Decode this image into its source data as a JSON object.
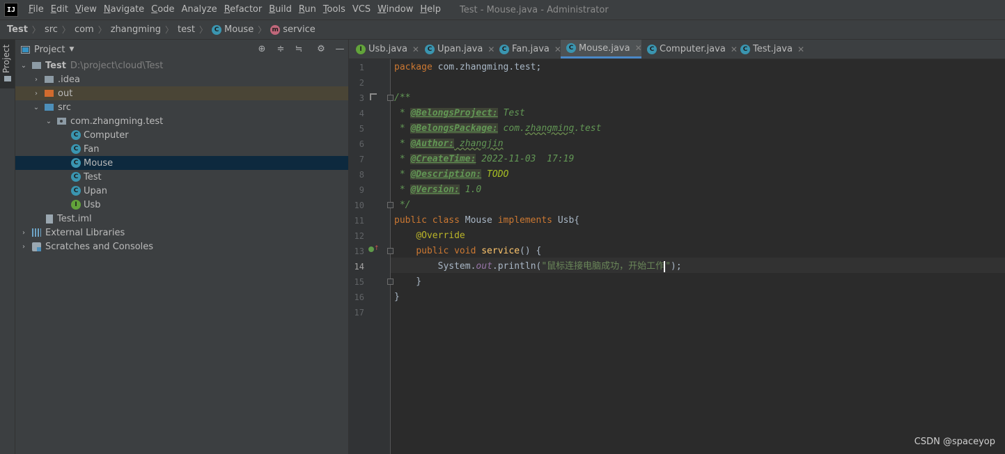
{
  "window_title": "Test - Mouse.java - Administrator",
  "logo_text": "IJ",
  "menu": [
    {
      "m": "F",
      "r": "ile"
    },
    {
      "m": "E",
      "r": "dit"
    },
    {
      "m": "V",
      "r": "iew"
    },
    {
      "m": "N",
      "r": "avigate"
    },
    {
      "m": "C",
      "r": "ode"
    },
    {
      "m": "",
      "r": "Analyze"
    },
    {
      "m": "R",
      "r": "efactor"
    },
    {
      "m": "B",
      "r": "uild"
    },
    {
      "m": "R",
      "r": "un"
    },
    {
      "m": "T",
      "r": "ools"
    },
    {
      "m": "",
      "r": "VCS"
    },
    {
      "m": "W",
      "r": "indow"
    },
    {
      "m": "H",
      "r": "elp"
    }
  ],
  "breadcrumb": {
    "items": [
      "Test",
      "src",
      "com",
      "zhangming",
      "test",
      "Mouse",
      "service"
    ],
    "class_icon": "C",
    "method_icon": "m"
  },
  "side_strip": {
    "label": "Project"
  },
  "project_panel": {
    "title": "Project",
    "icons": [
      "locate-icon",
      "expand-all-icon",
      "collapse-all-icon",
      "gear-icon",
      "minimize-icon"
    ],
    "tree": [
      {
        "label": "Test",
        "path": "D:\\project\\cloud\\Test"
      },
      {
        "label": ".idea"
      },
      {
        "label": "out"
      },
      {
        "label": "src"
      },
      {
        "label": "com.zhangming.test"
      },
      {
        "label": "Computer",
        "icon": "C"
      },
      {
        "label": "Fan",
        "icon": "C"
      },
      {
        "label": "Mouse",
        "icon": "C"
      },
      {
        "label": "Test",
        "icon": "C"
      },
      {
        "label": "Upan",
        "icon": "C"
      },
      {
        "label": "Usb",
        "icon": "I"
      },
      {
        "label": "Test.iml"
      },
      {
        "label": "External Libraries"
      },
      {
        "label": "Scratches and Consoles"
      }
    ]
  },
  "tabs": [
    {
      "label": "Usb.java",
      "icon": "I"
    },
    {
      "label": "Upan.java",
      "icon": "C"
    },
    {
      "label": "Fan.java",
      "icon": "C"
    },
    {
      "label": "Mouse.java",
      "icon": "C",
      "active": true
    },
    {
      "label": "Computer.java",
      "icon": "C"
    },
    {
      "label": "Test.java",
      "icon": "C"
    }
  ],
  "tab_close": "✕",
  "editor": {
    "line_numbers": [
      "1",
      "2",
      "3",
      "4",
      "5",
      "6",
      "7",
      "8",
      "9",
      "10",
      "11",
      "12",
      "13",
      "14",
      "15",
      "16",
      "17"
    ],
    "current_line": 14,
    "code": {
      "l1_kw": "package",
      "l1_rest": " com.zhangming.test;",
      "l3": "/**",
      "l4_pre": " * ",
      "l4_tag": "@BelongsProject:",
      "l4_val": " Test",
      "l5_pre": " * ",
      "l5_tag": "@BelongsPackage:",
      "l5_val_a": " com.",
      "l5_val_b": "zhangming",
      "l5_val_c": ".test",
      "l6_pre": " * ",
      "l6_tag": "@Author:",
      "l6_val": " zhangjin",
      "l7_pre": " * ",
      "l7_tag": "@CreateTime:",
      "l7_val": " 2022-11-03  17:19",
      "l8_pre": " * ",
      "l8_tag": "@Description:",
      "l8_val": " TODO",
      "l9_pre": " * ",
      "l9_tag": "@Version:",
      "l9_val": " 1.0",
      "l10": " */",
      "l11_kw": "public class",
      "l11_name": " Mouse ",
      "l11_kw2": "implements",
      "l11_rest": " Usb{",
      "l12_ind": "    ",
      "l12_ann": "@Override",
      "l13_ind": "    ",
      "l13_kw": "public void",
      "l13_fn": " service",
      "l13_rest": "() {",
      "l14_ind": "        ",
      "l14_sys": "System.",
      "l14_out": "out",
      "l14_call": ".println(",
      "l14_str_a": "\"鼠标连接电脑成功，开始工作",
      "l14_str_b": "\"",
      "l14_end": ");",
      "l15": "    }",
      "l16": "}"
    }
  },
  "watermark": "CSDN @spaceyop",
  "colors": {
    "keyword": "#cc7832",
    "doc_comment": "#629755",
    "annotation": "#bbb529",
    "method": "#ffc66d",
    "string": "#6a8759",
    "field": "#9876aa",
    "selection": "#0d293e",
    "tab_underline": "#4a88c7"
  }
}
